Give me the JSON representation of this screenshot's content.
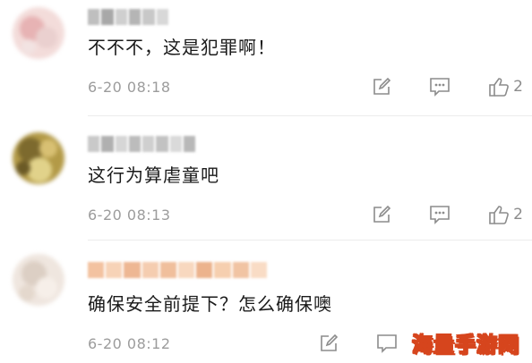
{
  "comments": [
    {
      "text": "不不不，这是犯罪啊！",
      "time": "6-20 08:18",
      "like_count": "2",
      "avatar_color": "#e9c8c6",
      "name_color": "#bdbdbd"
    },
    {
      "text": "这行为算虐童吧",
      "time": "6-20 08:13",
      "like_count": "2",
      "avatar_color": "#a88c3a",
      "name_color": "#c4c4c4"
    },
    {
      "text": "确保安全前提下？怎么确保噢",
      "time": "6-20 08:12",
      "like_count": "",
      "avatar_color": "#ece3dc",
      "name_color": "#f0c7a8"
    }
  ],
  "icons": {
    "edit": "edit-icon",
    "reply": "reply-icon",
    "like": "like-icon"
  },
  "watermark": "海量手游网",
  "colors": {
    "meta_gray": "#9c9c9c",
    "watermark_stroke": "#d6451d"
  }
}
